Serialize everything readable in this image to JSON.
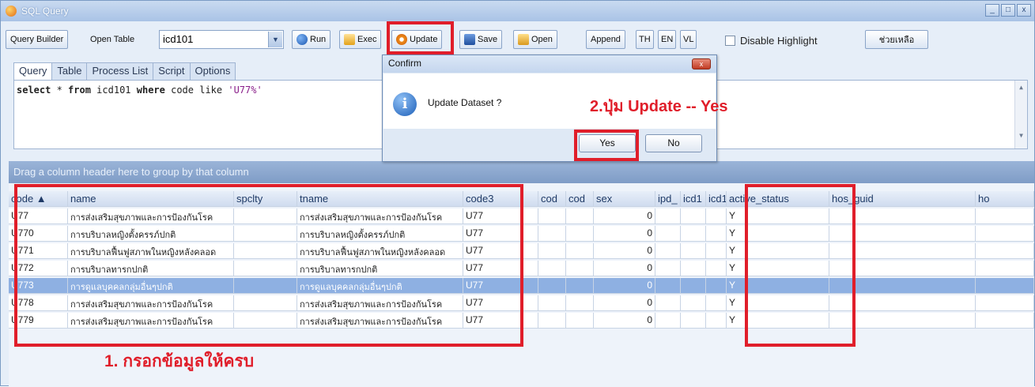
{
  "window": {
    "title": "SQL Query"
  },
  "toolbar": {
    "query_builder": "Query Builder",
    "open_table": "Open Table",
    "table_value": "icd101",
    "run": "Run",
    "exec": "Exec",
    "update": "Update",
    "save": "Save",
    "open": "Open",
    "append": "Append",
    "th": "TH",
    "en": "EN",
    "vl": "VL",
    "disable_highlight": "Disable Highlight",
    "help": "ช่วยเหลือ"
  },
  "tabs": [
    "Query",
    "Table",
    "Process List",
    "Script",
    "Options"
  ],
  "sql": {
    "select": "select",
    "star": " * ",
    "from": "from",
    "table": " icd101 ",
    "where": "where",
    "code_like": " code like ",
    "pattern": "'U77%'"
  },
  "group_panel": "Drag a column header here to group by that column",
  "grid": {
    "columns": [
      "code ▲",
      "name",
      "spclty",
      "tname",
      "code3",
      "cod",
      "cod",
      "sex",
      "ipd_",
      "icd1",
      "icd1",
      "active_status",
      "hos_guid",
      "ho"
    ],
    "rows": [
      [
        "U77",
        "การส่งเสริมสุขภาพและการป้องกันโรค",
        "",
        "การส่งเสริมสุขภาพและการป้องกันโรค",
        "U77",
        "",
        "",
        "0",
        "",
        "",
        "",
        "Y",
        "",
        ""
      ],
      [
        "U770",
        "การบริบาลหญิงตั้งครรภ์ปกติ",
        "",
        "การบริบาลหญิงตั้งครรภ์ปกติ",
        "U77",
        "",
        "",
        "0",
        "",
        "",
        "",
        "Y",
        "",
        ""
      ],
      [
        "U771",
        "การบริบาลฟื้นฟูสภาพในหญิงหลังคลอด",
        "",
        "การบริบาลฟื้นฟูสภาพในหญิงหลังคลอด",
        "U77",
        "",
        "",
        "0",
        "",
        "",
        "",
        "Y",
        "",
        ""
      ],
      [
        "U772",
        "การบริบาลทารกปกติ",
        "",
        "การบริบาลทารกปกติ",
        "U77",
        "",
        "",
        "0",
        "",
        "",
        "",
        "Y",
        "",
        ""
      ],
      [
        "U773",
        "การดูแลบุคคลกลุ่มอื่นๆปกติ",
        "",
        "การดูแลบุคคลกลุ่มอื่นๆปกติ",
        "U77",
        "",
        "",
        "0",
        "",
        "",
        "",
        "Y",
        "",
        ""
      ],
      [
        "U778",
        "การส่งเสริมสุขภาพและการป้องกันโรค",
        "",
        "การส่งเสริมสุขภาพและการป้องกันโรค",
        "U77",
        "",
        "",
        "0",
        "",
        "",
        "",
        "Y",
        "",
        ""
      ],
      [
        "U779",
        "การส่งเสริมสุขภาพและการป้องกันโรค",
        "",
        "การส่งเสริมสุขภาพและการป้องกันโรค",
        "U77",
        "",
        "",
        "0",
        "",
        "",
        "",
        "Y",
        "",
        ""
      ]
    ],
    "selected_row": 4
  },
  "dialog": {
    "title": "Confirm",
    "message": "Update Dataset ?",
    "yes": "Yes",
    "no": "No"
  },
  "annotations": {
    "step1": "1. กรอกข้อมูลให้ครบ",
    "step2": "2.ปุ่ม Update -- Yes",
    "color": "#e01e2a"
  }
}
